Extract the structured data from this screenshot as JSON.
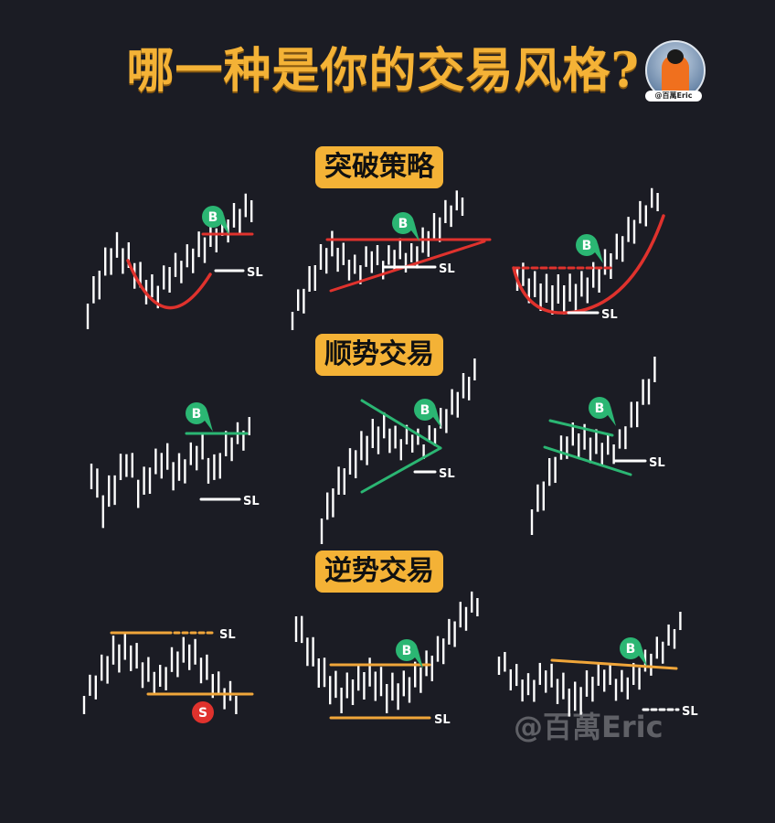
{
  "title": "哪一种是你的交易风格?",
  "avatar_handle": "@百萬Eric",
  "watermark": "@百萬Eric",
  "colors": {
    "background": "#1b1c24",
    "accent": "#f4b236",
    "bars": "#ffffff",
    "red_line": "#e0322d",
    "green_line": "#2bb673",
    "orange_line": "#f0a63a",
    "buy_marker": "#2bb673",
    "sell_marker": "#e0322d"
  },
  "sections": [
    {
      "label": "突破策略"
    },
    {
      "label": "顺势交易"
    },
    {
      "label": "逆势交易"
    }
  ],
  "markers": {
    "buy": "B",
    "sell": "S",
    "stop_loss": "SL"
  },
  "icons": [
    "avatar-photo",
    "buy-signal-icon",
    "sell-signal-icon"
  ]
}
